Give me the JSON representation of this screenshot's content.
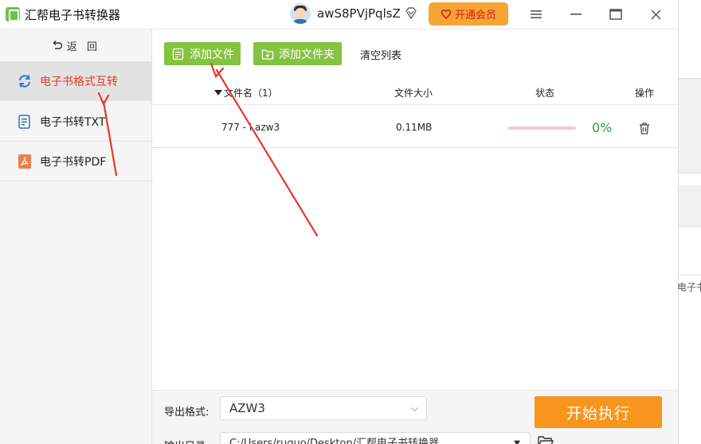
{
  "app": {
    "title": "汇帮电子书转换器"
  },
  "header": {
    "username": "awS8PVjPqlsZ",
    "vip_label": "开通会员",
    "menu_icon": "hamburger-icon",
    "minimize_icon": "minimize-icon",
    "maximize_icon": "maximize-icon",
    "close_icon": "close-icon"
  },
  "sidebar": {
    "back_label": "返 回",
    "items": [
      {
        "label": "电子书格式互转",
        "icon": "refresh-icon",
        "active": true
      },
      {
        "label": "电子书转TXT",
        "icon": "txt-file-icon",
        "active": false
      },
      {
        "label": "电子书转PDF",
        "icon": "pdf-file-icon",
        "active": false
      }
    ]
  },
  "toolbar": {
    "add_file": "添加文件",
    "add_folder": "添加文件夹",
    "clear_list": "清空列表"
  },
  "table": {
    "columns": {
      "name": "文件名（1）",
      "size": "文件大小",
      "status": "状态",
      "action": "操作"
    },
    "rows": [
      {
        "name": "777 - i.azw3",
        "size": "0.11MB",
        "progress": 0,
        "percent": "0%"
      }
    ]
  },
  "bottom": {
    "format_label": "导出格式:",
    "format_value": "AZW3",
    "dir_label": "输出目录:",
    "dir_value": "C:/Users/ruquo/Desktop/汇帮电子书转换器",
    "start_label": "开始执行"
  },
  "side_peek": {
    "text": "电子书"
  },
  "colors": {
    "accent_green": "#84c340",
    "accent_orange": "#f7951d",
    "active_red": "#e8372c",
    "percent_green": "#2b9a3e"
  }
}
